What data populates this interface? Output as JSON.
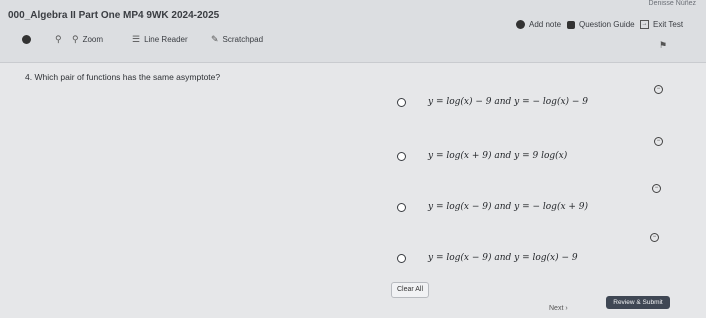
{
  "header": {
    "user_name": "Denisse Núñez",
    "doc_title": "000_Algebra II Part One MP4 9WK 2024-2025",
    "tools": {
      "zoom": "Zoom",
      "line_reader": "Line Reader",
      "scratchpad": "Scratchpad",
      "add_note": "Add note",
      "question_guide": "Question Guide",
      "exit_test": "Exit Test"
    }
  },
  "question": {
    "text": "4.  Which pair of functions has the same asymptote?",
    "choices": [
      {
        "text": "y = log(x) − 9 and y = − log(x) − 9"
      },
      {
        "text": "y = log(x + 9) and y = 9 log(x)"
      },
      {
        "text": "y = log(x − 9) and y = − log(x + 9)"
      },
      {
        "text": "y = log(x − 9) and y = log(x) − 9"
      }
    ]
  },
  "footer": {
    "clear_all": "Clear All",
    "next": "Next  ›",
    "review_submit": "Review & Submit"
  },
  "colors": {
    "background": "#e6e7e9",
    "submit_button": "#3f4754"
  }
}
